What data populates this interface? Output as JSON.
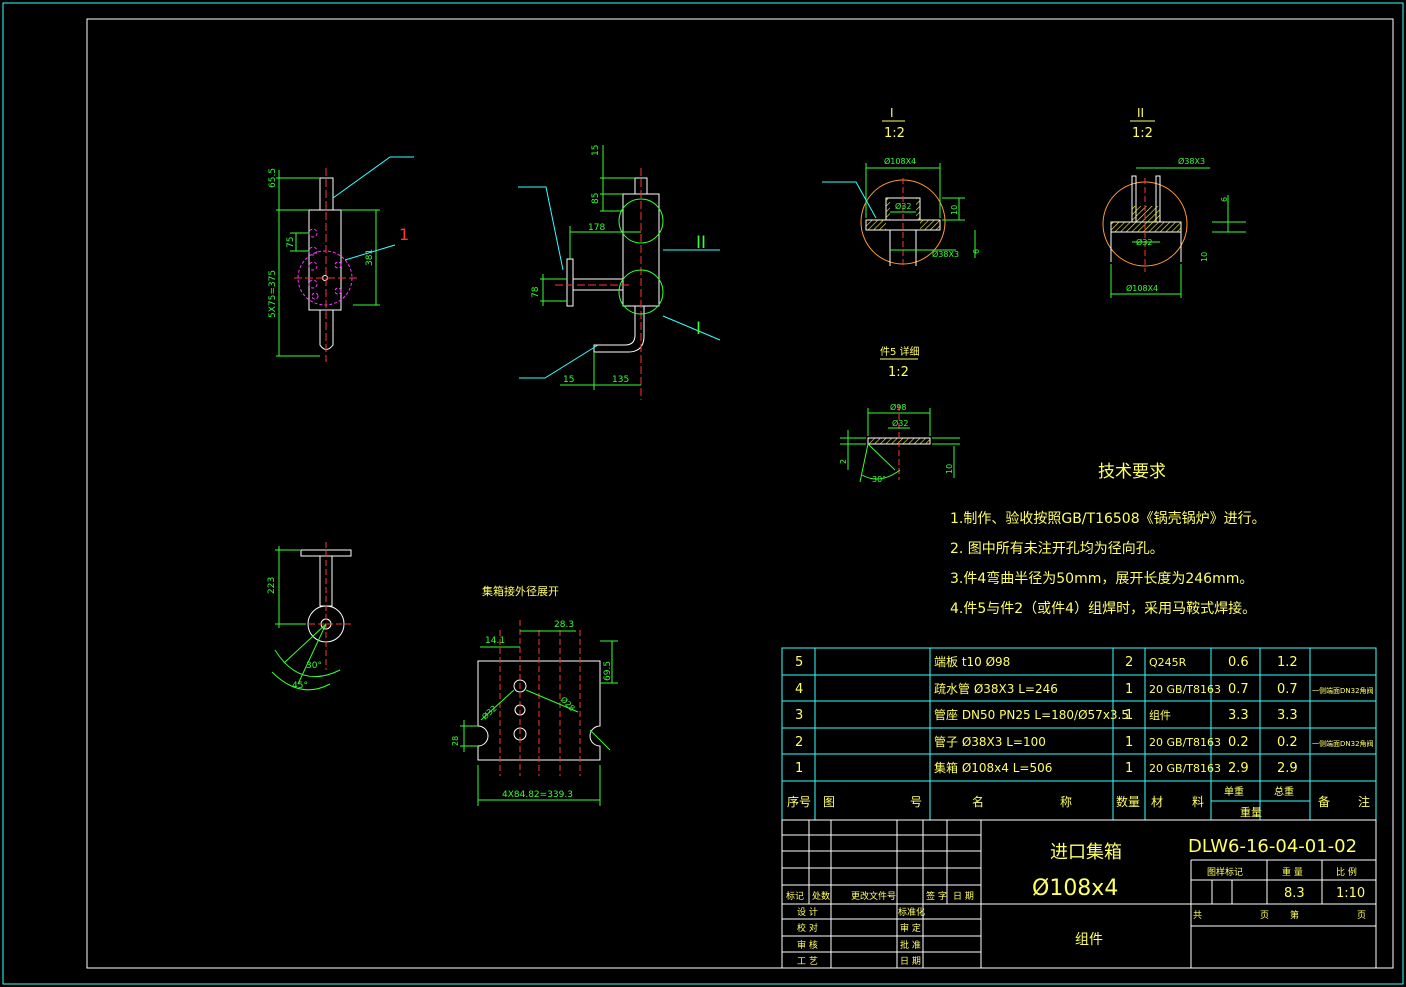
{
  "view_labels": {
    "detail_1_mark": "I",
    "detail_1_scale": "1:2",
    "detail_2_mark": "II",
    "detail_2_scale": "1:2",
    "part5_title": "件5 详细",
    "part5_scale": "1:2",
    "leader_1": "1",
    "leader_I": "I",
    "leader_II": "II",
    "unroll_title": "集箱接外径展开"
  },
  "dimensions": {
    "d_65_5": "65.5",
    "d_5x75": "5X75=375",
    "d_75": "75",
    "d_381": "381",
    "d_15_top": "15",
    "d_85": "85",
    "d_178": "178",
    "d_78": "78",
    "d_15_bottom": "15",
    "d_135": "135",
    "d_223": "223",
    "d_30_a": "30°",
    "d_45": "45°",
    "d1_108x4": "Ø108X4",
    "d1_32": "Ø32",
    "d1_38x3": "Ø38X3",
    "d1_10": "10",
    "d1_6": "6",
    "d2_38x3": "Ø38X3",
    "d2_32": "Ø32",
    "d2_6": "6",
    "d2_10": "10",
    "d2_108x4": "Ø108X4",
    "p5_98": "Ø98",
    "p5_32": "Ø32",
    "p5_2": "2",
    "p5_10": "10",
    "p5_30": "30°",
    "u_28_3": "28.3",
    "u_14_1": "14.1",
    "u_69_5": "69.5",
    "u_32": "Ø32",
    "u_28": "Ø28",
    "u_28v": "28",
    "u_4x": "4X84.82=339.3"
  },
  "tech_requirements": {
    "title": "技术要求",
    "lines": [
      "1.制作、验收按照GB/T16508《锅壳锅炉》进行。",
      "2. 图中所有未注开孔均为径向孔。",
      "3.件4弯曲半径为50mm，展开长度为246mm。",
      "4.件5与件2（或件4）组焊时，采用马鞍式焊接。"
    ]
  },
  "bom": {
    "rows": [
      {
        "no": "5",
        "code": "",
        "name": "端板 t10 Ø98",
        "qty": "2",
        "material": "Q245R",
        "unit": "0.6",
        "total": "1.2",
        "note": ""
      },
      {
        "no": "4",
        "code": "",
        "name": "疏水管 Ø38X3 L=246",
        "qty": "1",
        "material": "20 GB/T8163",
        "unit": "0.7",
        "total": "0.7",
        "note": "一侧端面DN32角阀"
      },
      {
        "no": "3",
        "code": "",
        "name": "管座 DN50 PN25 L=180/Ø57x3.5",
        "qty": "1",
        "material": "组件",
        "unit": "3.3",
        "total": "3.3",
        "note": ""
      },
      {
        "no": "2",
        "code": "",
        "name": "管子 Ø38X3 L=100",
        "qty": "1",
        "material": "20 GB/T8163",
        "unit": "0.2",
        "total": "0.2",
        "note": "一侧端面DN32角阀"
      },
      {
        "no": "1",
        "code": "",
        "name": "集箱 Ø108x4 L=506",
        "qty": "1",
        "material": "20 GB/T8163",
        "unit": "2.9",
        "total": "2.9",
        "note": ""
      }
    ],
    "header": {
      "no": "序号",
      "code_a": "图",
      "code_b": "号",
      "name_a": "名",
      "name_b": "称",
      "qty": "数量",
      "material_a": "材",
      "material_b": "料",
      "unit": "单重",
      "total": "总重",
      "weight": "重量",
      "note_a": "备",
      "note_b": "注"
    }
  },
  "title_block": {
    "drawing_name": "进口集箱",
    "drawing_spec": "Ø108x4",
    "drawing_number": "DLW6-16-04-01-02",
    "stage_label": "图样标记",
    "weight_label": "重 量",
    "scale_label": "比 例",
    "weight": "8.3",
    "scale": "1:10",
    "sheet_total": "共",
    "sheet_page": "页",
    "sheet_no": "第",
    "sheet_page2": "页",
    "category": "组件",
    "rev_headers": [
      "标记",
      "处数",
      "更改文件号",
      "签 字",
      "日 期"
    ],
    "sign_rows": [
      [
        "设 计",
        "标准化"
      ],
      [
        "校 对",
        "审 定"
      ],
      [
        "审 核",
        "批 准"
      ],
      [
        "工 艺",
        "日 期"
      ]
    ]
  },
  "colors": {
    "frame": "#ffffff",
    "table": "#33ffff",
    "dim": "#33ff33",
    "center": "#ff3333",
    "part": "#ffffff",
    "hidden": "#ff33ff",
    "hatch": "#ffff33",
    "detail_circle": "#ff9933",
    "text": "#ffff66"
  }
}
